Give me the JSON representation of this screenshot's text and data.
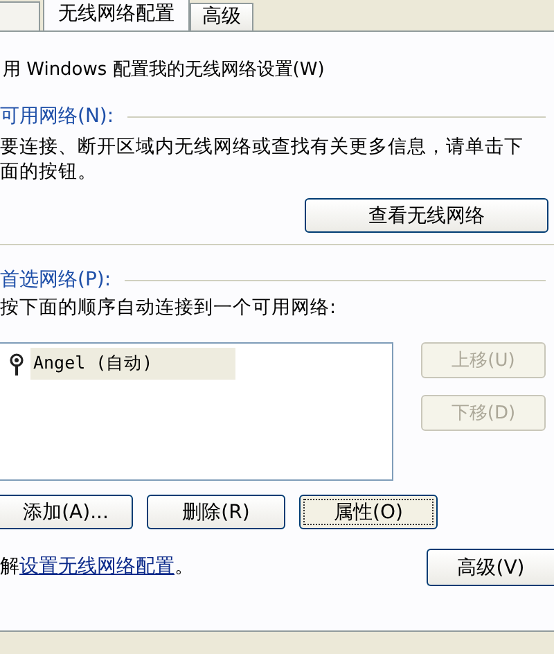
{
  "tabs": [
    {
      "label": "无线网络配置",
      "selected": true
    },
    {
      "label": "高级",
      "selected": false
    }
  ],
  "windows_setting": {
    "label": "用 Windows 配置我的无线网络设置(W)"
  },
  "available_networks": {
    "title": "可用网络(N):",
    "text": "要连接、断开区域内无线网络或查找有关更多信息，请单击下面的按钮。",
    "button": "查看无线网络"
  },
  "preferred_networks": {
    "title": "首选网络(P):",
    "text": "按下面的顺序自动连接到一个可用网络:",
    "networks": [
      {
        "name": "Angel (自动)",
        "selected": true
      }
    ],
    "side_buttons": [
      {
        "label": "上移(U)",
        "disabled": true
      },
      {
        "label": "下移(D)",
        "disabled": true
      }
    ],
    "buttons": [
      {
        "label": "添加(A)...",
        "focused": false
      },
      {
        "label": "删除(R)",
        "focused": false
      },
      {
        "label": "属性(O)",
        "focused": true
      }
    ]
  },
  "footer": {
    "text": "解",
    "link": "设置无线网络配置",
    "suffix": "。",
    "button": "高级(V)"
  }
}
